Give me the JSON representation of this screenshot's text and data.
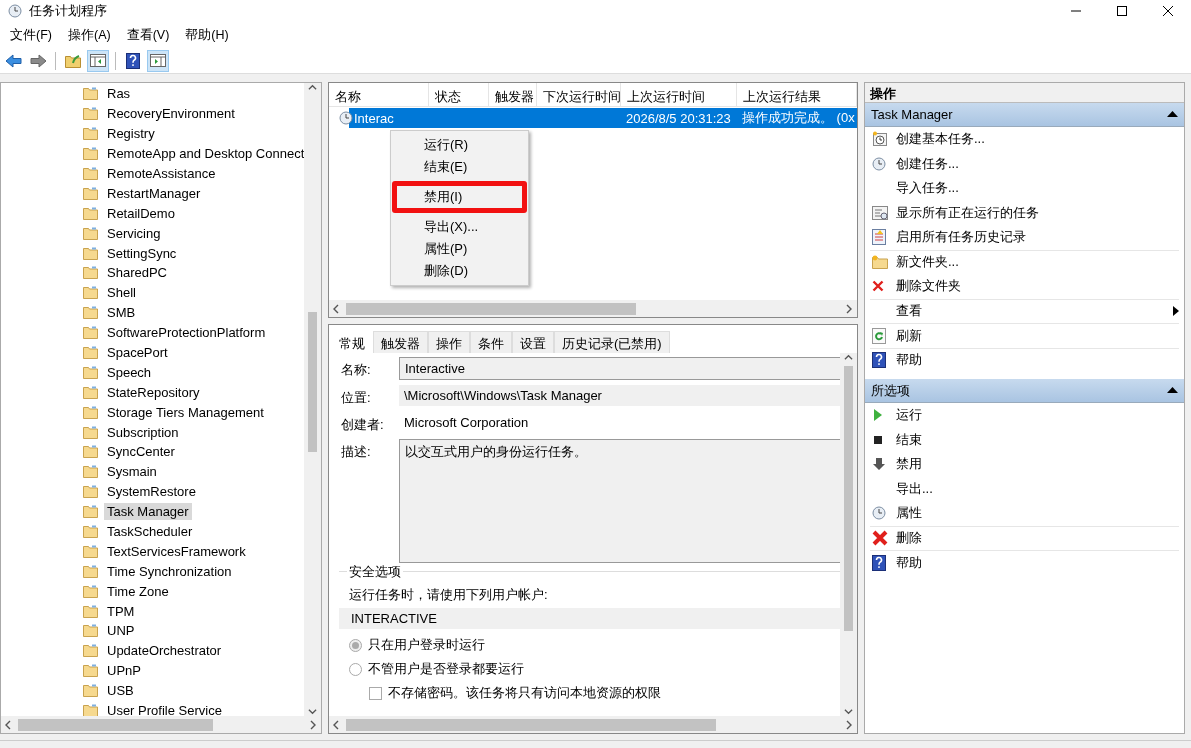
{
  "window": {
    "title": "任务计划程序"
  },
  "menu_bar": [
    "文件(F)",
    "操作(A)",
    "查看(V)",
    "帮助(H)"
  ],
  "tree": {
    "items": [
      {
        "label": "Ras",
        "selected": false
      },
      {
        "label": "RecoveryEnvironment",
        "selected": false
      },
      {
        "label": "Registry",
        "selected": false
      },
      {
        "label": "RemoteApp and Desktop Connect",
        "selected": false
      },
      {
        "label": "RemoteAssistance",
        "selected": false
      },
      {
        "label": "RestartManager",
        "selected": false
      },
      {
        "label": "RetailDemo",
        "selected": false
      },
      {
        "label": "Servicing",
        "selected": false
      },
      {
        "label": "SettingSync",
        "selected": false
      },
      {
        "label": "SharedPC",
        "selected": false
      },
      {
        "label": "Shell",
        "selected": false
      },
      {
        "label": "SMB",
        "selected": false
      },
      {
        "label": "SoftwareProtectionPlatform",
        "selected": false
      },
      {
        "label": "SpacePort",
        "selected": false
      },
      {
        "label": "Speech",
        "selected": false
      },
      {
        "label": "StateRepository",
        "selected": false
      },
      {
        "label": "Storage Tiers Management",
        "selected": false
      },
      {
        "label": "Subscription",
        "selected": false
      },
      {
        "label": "SyncCenter",
        "selected": false
      },
      {
        "label": "Sysmain",
        "selected": false
      },
      {
        "label": "SystemRestore",
        "selected": false
      },
      {
        "label": "Task Manager",
        "selected": true
      },
      {
        "label": "TaskScheduler",
        "selected": false
      },
      {
        "label": "TextServicesFramework",
        "selected": false
      },
      {
        "label": "Time Synchronization",
        "selected": false
      },
      {
        "label": "Time Zone",
        "selected": false
      },
      {
        "label": "TPM",
        "selected": false
      },
      {
        "label": "UNP",
        "selected": false
      },
      {
        "label": "UpdateOrchestrator",
        "selected": false
      },
      {
        "label": "UPnP",
        "selected": false
      },
      {
        "label": "USB",
        "selected": false
      },
      {
        "label": "User Profile Service",
        "selected": false
      }
    ]
  },
  "task_table": {
    "columns": [
      "名称",
      "状态",
      "触发器",
      "下次运行时间",
      "上次运行时间",
      "上次运行结果"
    ],
    "rows": [
      {
        "cells": [
          "Interac",
          "",
          "",
          "",
          "2026/8/5 20:31:23",
          "操作成功完成。 (0x"
        ],
        "selected": true
      }
    ]
  },
  "context_menu": {
    "items": [
      {
        "label": "运行(R)",
        "highlighted": false
      },
      {
        "label": "结束(E)",
        "highlighted": false
      },
      {
        "label": "禁用(I)",
        "highlighted": true
      },
      {
        "label": "导出(X)...",
        "highlighted": false
      },
      {
        "label": "属性(P)",
        "highlighted": false
      },
      {
        "label": "删除(D)",
        "highlighted": false
      }
    ]
  },
  "detail_tabs": [
    {
      "label": "常规",
      "selected": true
    },
    {
      "label": "触发器",
      "selected": false
    },
    {
      "label": "操作",
      "selected": false
    },
    {
      "label": "条件",
      "selected": false
    },
    {
      "label": "设置",
      "selected": false
    },
    {
      "label": "历史记录(已禁用)",
      "selected": false
    }
  ],
  "general": {
    "name_label": "名称:",
    "name": "Interactive",
    "location_label": "位置:",
    "location": "\\Microsoft\\Windows\\Task Manager",
    "author_label": "创建者:",
    "author": "Microsoft Corporation",
    "description_label": "描述:",
    "description": "以交互式用户的身份运行任务。",
    "security": {
      "title": "安全选项",
      "prompt": "运行任务时，请使用下列用户帐户:",
      "account": "INTERACTIVE",
      "options": [
        {
          "label": "只在用户登录时运行",
          "selected": true
        },
        {
          "label": "不管用户是否登录都要运行",
          "selected": false
        }
      ],
      "no_password": {
        "label": "不存储密码。该任务将只有访问本地资源的权限",
        "checked": false
      }
    }
  },
  "actions_pane": {
    "title": "操作",
    "sections": [
      {
        "title": "Task Manager",
        "expanded": true,
        "items": [
          {
            "label": "创建基本任务...",
            "divider_before": false,
            "submenu": false
          },
          {
            "label": "创建任务...",
            "divider_before": false,
            "submenu": false
          },
          {
            "label": "导入任务...",
            "divider_before": false,
            "submenu": false
          },
          {
            "label": "显示所有正在运行的任务",
            "divider_before": false,
            "submenu": false
          },
          {
            "label": "启用所有任务历史记录",
            "divider_before": false,
            "submenu": false
          },
          {
            "label": "新文件夹...",
            "divider_before": true,
            "submenu": false
          },
          {
            "label": "删除文件夹",
            "divider_before": false,
            "submenu": false
          },
          {
            "label": "查看",
            "divider_before": true,
            "submenu": true
          },
          {
            "label": "刷新",
            "divider_before": true,
            "submenu": false
          },
          {
            "label": "帮助",
            "divider_before": true,
            "submenu": false
          }
        ]
      },
      {
        "title": "所选项",
        "expanded": true,
        "items": [
          {
            "label": "运行",
            "divider_before": false,
            "submenu": false
          },
          {
            "label": "结束",
            "divider_before": false,
            "submenu": false
          },
          {
            "label": "禁用",
            "divider_before": false,
            "submenu": false
          },
          {
            "label": "导出...",
            "divider_before": false,
            "submenu": false
          },
          {
            "label": "属性",
            "divider_before": false,
            "submenu": false
          },
          {
            "label": "删除",
            "divider_before": true,
            "submenu": false
          },
          {
            "label": "帮助",
            "divider_before": true,
            "submenu": false
          }
        ]
      }
    ]
  }
}
